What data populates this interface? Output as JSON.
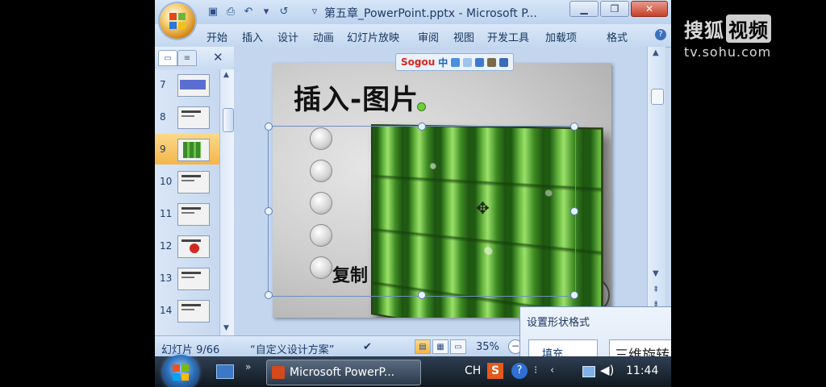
{
  "window": {
    "title": "第五章_PowerPoint.pptx - Microsoft P...",
    "minimize_icon": "minimize-icon",
    "restore_icon": "restore-icon",
    "close_icon": "close-icon"
  },
  "ribbon": {
    "tabs": [
      "开始",
      "插入",
      "设计",
      "动画",
      "幻灯片放映",
      "审阅",
      "视图",
      "开发工具",
      "加载项",
      "格式"
    ]
  },
  "slides_pane": {
    "close_glyph": "✕",
    "items": [
      {
        "num": "7",
        "thumb": "blue"
      },
      {
        "num": "8",
        "thumb": "text"
      },
      {
        "num": "9",
        "thumb": "bamboo",
        "selected": true
      },
      {
        "num": "10",
        "thumb": "text"
      },
      {
        "num": "11",
        "thumb": "text"
      },
      {
        "num": "12",
        "thumb": "red"
      },
      {
        "num": "13",
        "thumb": "text"
      },
      {
        "num": "14",
        "thumb": "text"
      }
    ]
  },
  "slide": {
    "title": "插入-图片",
    "body_fragment": "复制"
  },
  "ime": {
    "logo": "Sogou",
    "mode": "中"
  },
  "statusbar": {
    "slide_info": "幻灯片 9/66",
    "theme": "“自定义设计方案”",
    "zoom": "35%"
  },
  "format_dialog": {
    "title": "设置形状格式",
    "fill_tab": "填充",
    "rotation_tab": "三维旋转"
  },
  "taskbar": {
    "app_label": "Microsoft PowerP...",
    "ime_indicator": "CH",
    "sogou_tray": "S",
    "help_tray": "?",
    "time": "11:44"
  },
  "watermark": {
    "brand": "搜狐",
    "brand_box": "视频",
    "url": "tv.sohu.com"
  }
}
